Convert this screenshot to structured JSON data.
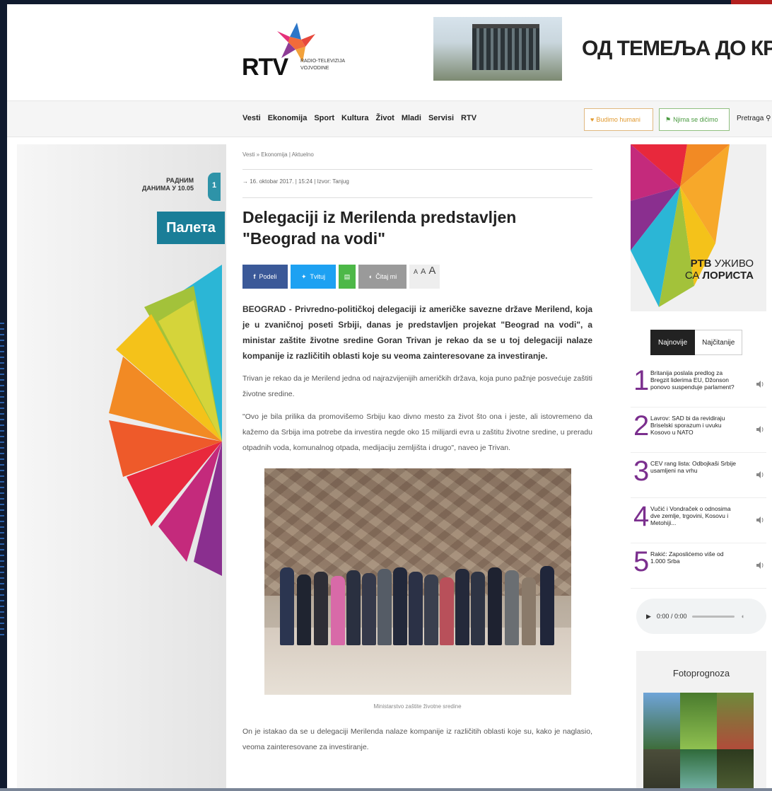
{
  "header": {
    "logo_text": "RTV",
    "logo_subtitle": "RADIO-TELEVIZIJA VOJVODINE",
    "banner_text": "ОД ТЕМЕЉА ДО КРОВА"
  },
  "nav": {
    "items": [
      "Vesti",
      "Ekonomija",
      "Sport",
      "Kultura",
      "Život",
      "Mladi",
      "Servisi",
      "RTV"
    ],
    "btn_humani": "Budimo humani",
    "btn_dizimo": "Njima se dičimo",
    "search_label": "Pretraga"
  },
  "left_ad": {
    "schedule": "РАДНИМ ДАНИМА У 10.05",
    "channel": "1",
    "title": "Палета"
  },
  "article": {
    "breadcrumb": "Vesti » Ekonomija | Aktuelno",
    "dateline": "16. oktobar 2017. | 15:24 | Izvor: Tanjug",
    "headline": "Delegaciji iz Merilenda predstavljen \"Beograd na vodi\"",
    "share": {
      "facebook": "Podeli",
      "twitter": "Tvituj",
      "read": "Čitaj mi",
      "font_sizes": [
        "A",
        "A",
        "A"
      ]
    },
    "lead": "BEOGRAD - Privredno-političkoj delegaciji iz američke savezne države Merilend, koja je u zvaničnoj poseti Srbiji, danas je predstavljen projekat \"Beograd na vodi\", a ministar zaštite životne sredine Goran Trivan je rekao da se u toj delegaciji nalaze kompanije iz različitih oblasti koje su veoma zainteresovane za investiranje.",
    "para1": "Trivan je rekao da je Merilend jedna od najrazvijenijih američkih država, koja puno pažnje posvećuje zaštiti životne sredine.",
    "para2": "\"Ovo je bila prilika da promovišemo Srbiju kao divno mesto za život što ona i jeste, ali istovremeno da kažemo da Srbija ima potrebe da investira negde oko 15 milijardi evra u zaštitu životne sredine, u preradu otpadnih voda, komunalnog otpada, medijaciju zemljišta i drugo\", naveo je Trivan.",
    "caption": "Ministarstvo zaštite životne sredine",
    "para3": "On je istakao da se u delegaciji Merilenda nalaze kompanije iz različitih oblasti koje su, kako je naglasio, veoma zainteresovane za investiranje."
  },
  "sidebar": {
    "live_ad": {
      "line1": "РТВ",
      "line1b": "УЖИВО",
      "line2a": "СА",
      "line2b": "ЛОРИСТА"
    },
    "tabs": [
      "Najnovije",
      "Najčitanije"
    ],
    "news": [
      {
        "num": "1",
        "text": "Britanija poslala predlog za Bregzit liderima EU, Džonson ponovo suspenduje parlament?"
      },
      {
        "num": "2",
        "text": "Lavrov: SAD bi da revidiraju Briselski sporazum i uvuku Kosovo u NATO"
      },
      {
        "num": "3",
        "text": "CEV rang lista: Odbojkaši Srbije usamljeni na vrhu"
      },
      {
        "num": "4",
        "text": "Vučić i Vondraček o odnosima dve zemlje, trgovini, Kosovu i Metohiji..."
      },
      {
        "num": "5",
        "text": "Rakić: Zaposlićemo više od 1.000 Srba"
      }
    ],
    "audio_time": "0:00 / 0:00",
    "foto_title": "Fotoprognoza"
  },
  "colors": {
    "nav_bg": "#f5f5f5",
    "facebook": "#3b5998",
    "twitter": "#1da1f2",
    "news_number": "#7b2f8e",
    "paleta": "#1a7e98"
  }
}
